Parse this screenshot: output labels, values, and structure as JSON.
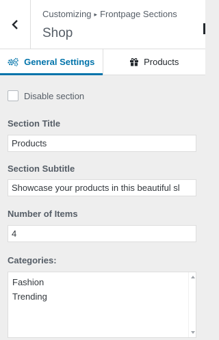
{
  "header": {
    "breadcrumb_root": "Customizing",
    "breadcrumb_separator": "▸",
    "breadcrumb_section": "Frontpage Sections",
    "title": "Shop"
  },
  "tabs": [
    {
      "label": "General Settings",
      "icon": "gears-icon",
      "active": true
    },
    {
      "label": "Products",
      "icon": "gift-icon",
      "active": false
    }
  ],
  "form": {
    "disable_section_label": "Disable section",
    "disable_section_checked": false,
    "section_title_label": "Section Title",
    "section_title_value": "Products",
    "section_subtitle_label": "Section Subtitle",
    "section_subtitle_value": "Showcase your products in this beautiful sl",
    "number_of_items_label": "Number of Items",
    "number_of_items_value": "4",
    "categories_label": "Categories:",
    "categories_options": [
      "Fashion",
      "Trending"
    ]
  },
  "colors": {
    "accent": "#0073aa",
    "panel_bg": "#eeeeee",
    "text": "#555d66"
  }
}
